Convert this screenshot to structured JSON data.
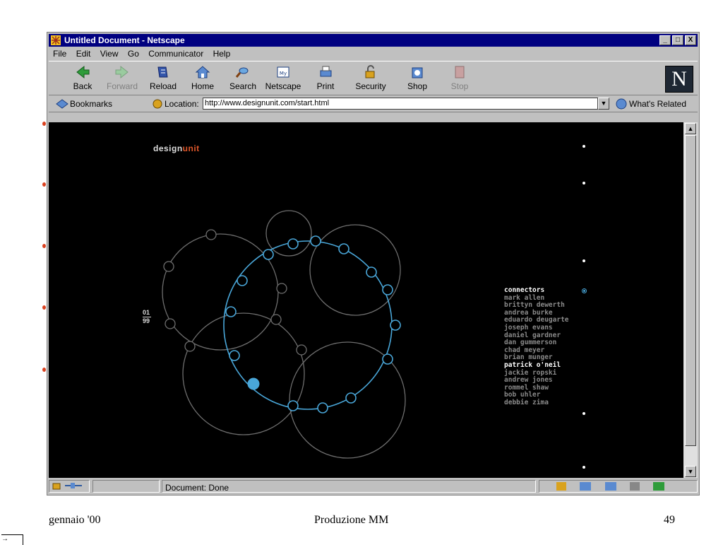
{
  "window": {
    "title": "Untitled Document - Netscape",
    "controls": [
      "_",
      "□",
      "X"
    ]
  },
  "menu": [
    "File",
    "Edit",
    "View",
    "Go",
    "Communicator",
    "Help"
  ],
  "toolbar": [
    {
      "label": "Back",
      "icon": "back-arrow-icon",
      "enabled": true
    },
    {
      "label": "Forward",
      "icon": "forward-arrow-icon",
      "enabled": false
    },
    {
      "label": "Reload",
      "icon": "reload-icon",
      "enabled": true
    },
    {
      "label": "Home",
      "icon": "home-icon",
      "enabled": true
    },
    {
      "label": "Search",
      "icon": "search-icon",
      "enabled": true
    },
    {
      "label": "Netscape",
      "icon": "netscape-icon",
      "enabled": true
    },
    {
      "label": "Print",
      "icon": "print-icon",
      "enabled": true
    },
    {
      "label": "Security",
      "icon": "lock-icon",
      "enabled": true
    },
    {
      "label": "Shop",
      "icon": "shop-icon",
      "enabled": true
    },
    {
      "label": "Stop",
      "icon": "stop-icon",
      "enabled": false
    }
  ],
  "netscape_logo": "N",
  "locationbar": {
    "bookmarks_label": "Bookmarks",
    "location_label": "Location:",
    "url": "http://www.designunit.com/start.html",
    "related_label": "What's Related"
  },
  "page": {
    "logo_main": "design",
    "logo_accent": "unit",
    "date_top": "01",
    "date_bottom": "99",
    "heading": "connectors",
    "names": [
      "mark allen",
      "brittyn dewerth",
      "andrea burke",
      "eduardo deugarte",
      "joseph evans",
      "daniel gardner",
      "dan gummerson",
      "chad meyer",
      "brian munger",
      "patrick o'neil",
      "jackie ropski",
      "andrew jones",
      "rommel shaw",
      "bob uhler",
      "debbie zima"
    ],
    "highlighted_name": "patrick o'neil",
    "colors": {
      "accent_orange": "#e0572a",
      "network_blue": "#49a6d8",
      "circle_gray": "#6e6e6e"
    }
  },
  "status": {
    "text": "Document: Done"
  },
  "slide_footer": {
    "left": "gennaio '00",
    "center": "Produzione MM",
    "right": "49"
  }
}
